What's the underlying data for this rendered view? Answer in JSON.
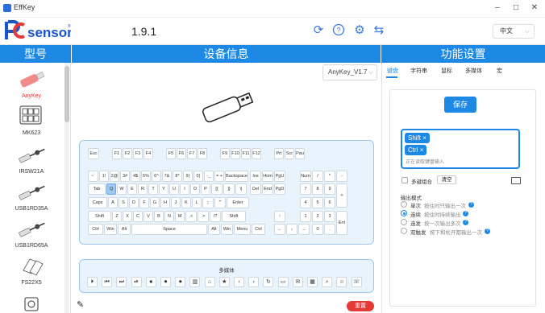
{
  "window": {
    "title": "EffKey",
    "min": "–",
    "max": "□",
    "close": "✕"
  },
  "header": {
    "version": "1.9.1",
    "language": "中文"
  },
  "columns": {
    "model": "型号",
    "device_info": "设备信息",
    "function": "功能设置"
  },
  "devices": [
    "AnyKey",
    "MK623",
    "IRSW21A",
    "USB1RD35A",
    "USB1RD65A",
    "FS22X5"
  ],
  "firmware": "AnyKey_V1.7",
  "keyboard": {
    "row0": [
      "Esc",
      "F1",
      "F2",
      "F3",
      "F4",
      "F5",
      "F6",
      "F7",
      "F8",
      "F9",
      "F10",
      "F11",
      "F12",
      "Prt",
      "Scr",
      "Pau"
    ],
    "row1": [
      "~`",
      "1!",
      "2@",
      "3#",
      "4$",
      "5%",
      "6^",
      "7&",
      "8*",
      "9(",
      "0)",
      "-_",
      "= +",
      "Backspace",
      "Ins",
      "Hom",
      "PgU",
      "Num",
      "/",
      "*",
      "-"
    ],
    "row2": [
      "Tab",
      "Q",
      "W",
      "E",
      "R",
      "T",
      "Y",
      "U",
      "I",
      "O",
      "P",
      "[{",
      "]}",
      "\\|",
      "Del",
      "End",
      "PgD",
      "7",
      "8",
      "9",
      "+"
    ],
    "row3": [
      "Caps",
      "A",
      "S",
      "D",
      "F",
      "G",
      "H",
      "J",
      "K",
      "L",
      ";:",
      "'\"",
      "Enter",
      "4",
      "5",
      "6"
    ],
    "row4": [
      "Shift",
      "Z",
      "X",
      "C",
      "V",
      "B",
      "N",
      "M",
      ",<",
      ".>",
      "/?",
      "Shift",
      "↑",
      "1",
      "2",
      "3",
      "Ent"
    ],
    "row5": [
      "Ctrl",
      "Win",
      "Alt",
      "Space",
      "Alt",
      "Win",
      "Menu",
      "Ctrl",
      "←",
      "↓",
      "→",
      "0",
      "."
    ]
  },
  "media": {
    "label": "多媒体",
    "keys": [
      "⏵",
      "⏮",
      "⏭",
      "⏯",
      "⏹",
      "⏺",
      "⏺",
      "▥",
      "⌂",
      "★",
      "‹",
      "›",
      "↻",
      "▭",
      "✉",
      "▦",
      "⌕",
      "☺",
      "☏"
    ]
  },
  "reset_label": "重置",
  "right": {
    "tabs": [
      "键盘",
      "字符串",
      "鼠标",
      "多媒体",
      "宏"
    ],
    "save": "保存",
    "chips": [
      "Shift",
      "Ctrl"
    ],
    "chip_close": "×",
    "hint": "正在读取键盘输入",
    "multi_combo": "多键组合",
    "clear": "清空",
    "output_mode": "输出模式",
    "modes": [
      {
        "name": "单次",
        "desc": "按住时只输出一次"
      },
      {
        "name": "连续",
        "desc": "按住时持续输出"
      },
      {
        "name": "连发",
        "desc": "按一次输出多次"
      },
      {
        "name": "双触发",
        "desc": "按下和松开都输出一次"
      }
    ],
    "selected_mode": 1,
    "help_mark": "?"
  },
  "colors": {
    "accent": "#1e88e5",
    "reset": "#e53935",
    "panel_bg": "#e9f3fc"
  },
  "icons": [
    "refresh-icon",
    "help-icon",
    "settings-icon",
    "usb-icon",
    "edit-icon",
    "keyboard-icon"
  ]
}
